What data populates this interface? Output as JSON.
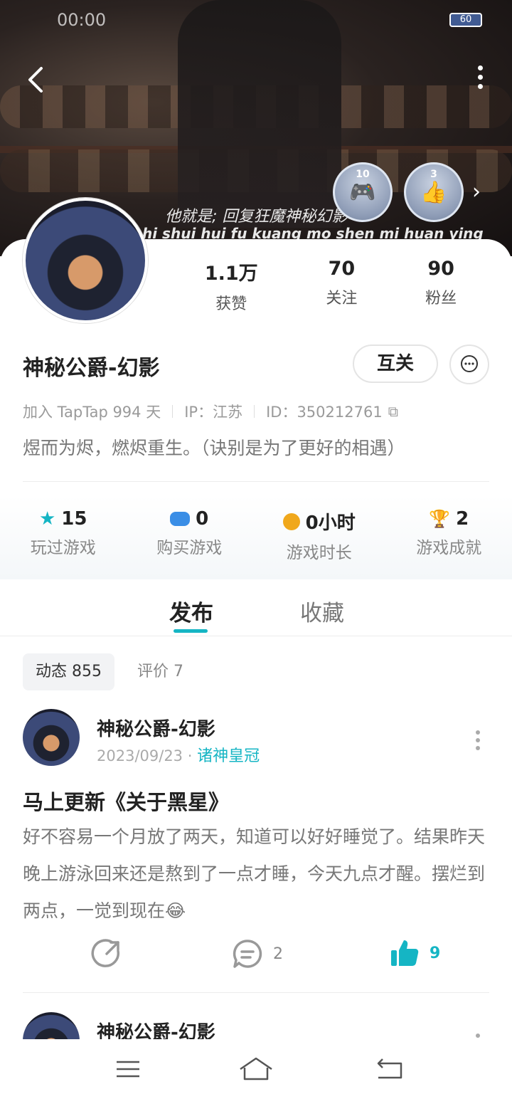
{
  "status": {
    "time": "00:00",
    "battery": "60"
  },
  "cover": {
    "subtitle_cn": "他就是; 回复狂魔神秘幻影",
    "subtitle_pinyin": "hi shui hui fu kuang mo shen mi huan ying",
    "badges": [
      {
        "number": "10",
        "icon": "gamepad-icon"
      },
      {
        "number": "3",
        "icon": "thumbs-up-icon"
      }
    ]
  },
  "profile": {
    "name": "神秘公爵-幻影",
    "follow_label": "互关",
    "stats": [
      {
        "value": "1.1万",
        "label": "获赞"
      },
      {
        "value": "70",
        "label": "关注"
      },
      {
        "value": "90",
        "label": "粉丝"
      }
    ],
    "join": "加入 TapTap 994 天",
    "ip": "IP：江苏",
    "id": "ID：350212761",
    "bio": "煜而为烬，燃烬重生。（诀别是为了更好的相遇）"
  },
  "game_stats": [
    {
      "value": "15",
      "label": "玩过游戏",
      "icon": "star-icon",
      "color": "#15b5c4"
    },
    {
      "value": "0",
      "label": "购买游戏",
      "icon": "gamepad-icon",
      "color": "#3a8ee6"
    },
    {
      "value": "0小时",
      "label": "游戏时长",
      "icon": "timer-icon",
      "color": "#f0a81c"
    },
    {
      "value": "2",
      "label": "游戏成就",
      "icon": "trophy-icon",
      "color": "#2fb85a"
    }
  ],
  "tabs": {
    "publish": "发布",
    "collect": "收藏"
  },
  "subtabs": {
    "dynamic": "动态 855",
    "review": "评价 7"
  },
  "posts": [
    {
      "author": "神秘公爵-幻影",
      "date": "2023/09/23",
      "tag": "诸神皇冠",
      "title": "马上更新《关于黑星》",
      "body": "好不容易一个月放了两天，知道可以好好睡觉了。结果昨天晚上游泳回来还是熬到了一点才睡，今天九点才醒。摆烂到两点，一觉到现在😂",
      "comments": "2",
      "likes": "9"
    },
    {
      "author": "神秘公爵-幻影"
    }
  ],
  "accent_color": "#15b5c4"
}
